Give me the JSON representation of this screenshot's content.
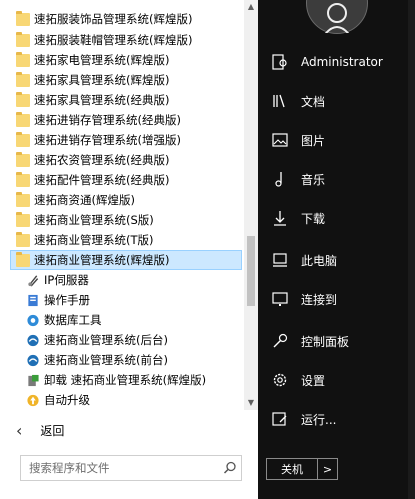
{
  "programs": [
    {
      "label": "速拓服装饰品管理系统(辉煌版)",
      "icon": "folder-icon"
    },
    {
      "label": "速拓服装鞋帽管理系统(辉煌版)",
      "icon": "folder-icon"
    },
    {
      "label": "速拓家电管理系统(辉煌版)",
      "icon": "folder-icon"
    },
    {
      "label": "速拓家具管理系统(辉煌版)",
      "icon": "folder-icon"
    },
    {
      "label": "速拓家具管理系统(经典版)",
      "icon": "folder-icon"
    },
    {
      "label": "速拓进销存管理系统(经典版)",
      "icon": "folder-icon"
    },
    {
      "label": "速拓进销存管理系统(增强版)",
      "icon": "folder-icon"
    },
    {
      "label": "速拓农资管理系统(经典版)",
      "icon": "folder-icon"
    },
    {
      "label": "速拓配件管理系统(经典版)",
      "icon": "folder-icon"
    },
    {
      "label": "速拓商资通(辉煌版)",
      "icon": "folder-icon"
    },
    {
      "label": "速拓商业管理系统(S版)",
      "icon": "folder-icon"
    },
    {
      "label": "速拓商业管理系统(T版)",
      "icon": "folder-icon"
    },
    {
      "label": "速拓商业管理系统(辉煌版)",
      "icon": "folder-icon",
      "selected": true
    },
    {
      "label": "IP伺服器",
      "icon": "ip-server-icon"
    },
    {
      "label": "操作手册",
      "icon": "manual-icon"
    },
    {
      "label": "数据库工具",
      "icon": "database-tool-icon"
    },
    {
      "label": "速拓商业管理系统(后台)",
      "icon": "app-backend-icon"
    },
    {
      "label": "速拓商业管理系统(前台)",
      "icon": "app-frontend-icon"
    },
    {
      "label": "卸载 速拓商业管理系统(辉煌版)",
      "icon": "uninstall-icon"
    },
    {
      "label": "自动升级",
      "icon": "auto-upgrade-icon"
    }
  ],
  "back": {
    "label": "返回"
  },
  "search": {
    "placeholder": "搜索程序和文件"
  },
  "user": {
    "name": "Administrator"
  },
  "right_menu": [
    {
      "label": "文档",
      "icon": "documents-icon"
    },
    {
      "label": "图片",
      "icon": "pictures-icon"
    },
    {
      "label": "音乐",
      "icon": "music-icon"
    },
    {
      "label": "下载",
      "icon": "downloads-icon"
    },
    {
      "label": "此电脑",
      "icon": "this-pc-icon"
    },
    {
      "label": "连接到",
      "icon": "connect-icon"
    },
    {
      "label": "控制面板",
      "icon": "control-panel-icon"
    },
    {
      "label": "设置",
      "icon": "settings-icon"
    },
    {
      "label": "运行...",
      "icon": "run-icon"
    }
  ],
  "power": {
    "label": "关机",
    "more": ">"
  },
  "colors": {
    "folder": "#f8d775",
    "selection": "#cce8ff",
    "right_panel": "#111111"
  }
}
